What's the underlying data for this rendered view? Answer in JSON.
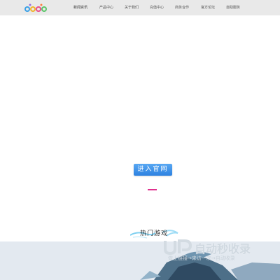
{
  "header": {
    "logo_name": "site-logo",
    "nav": [
      {
        "label": "新闻资讯"
      },
      {
        "label": "产品中心"
      },
      {
        "label": "关于我们"
      },
      {
        "label": "充值中心"
      },
      {
        "label": "商务合作"
      },
      {
        "label": "官方论坛"
      },
      {
        "label": "自助服务"
      }
    ]
  },
  "hero": {
    "enter_button": "进入官网"
  },
  "hot_games": {
    "title": "热门游戏"
  },
  "watermark": {
    "title": "自动秒收录",
    "subtitle": "做上链接→来访一次→自动收录"
  },
  "colors": {
    "topbar": "#e9e9e9",
    "button": "#2d81e0",
    "accent": "#e0318e",
    "banner": "#e3e9f0"
  }
}
